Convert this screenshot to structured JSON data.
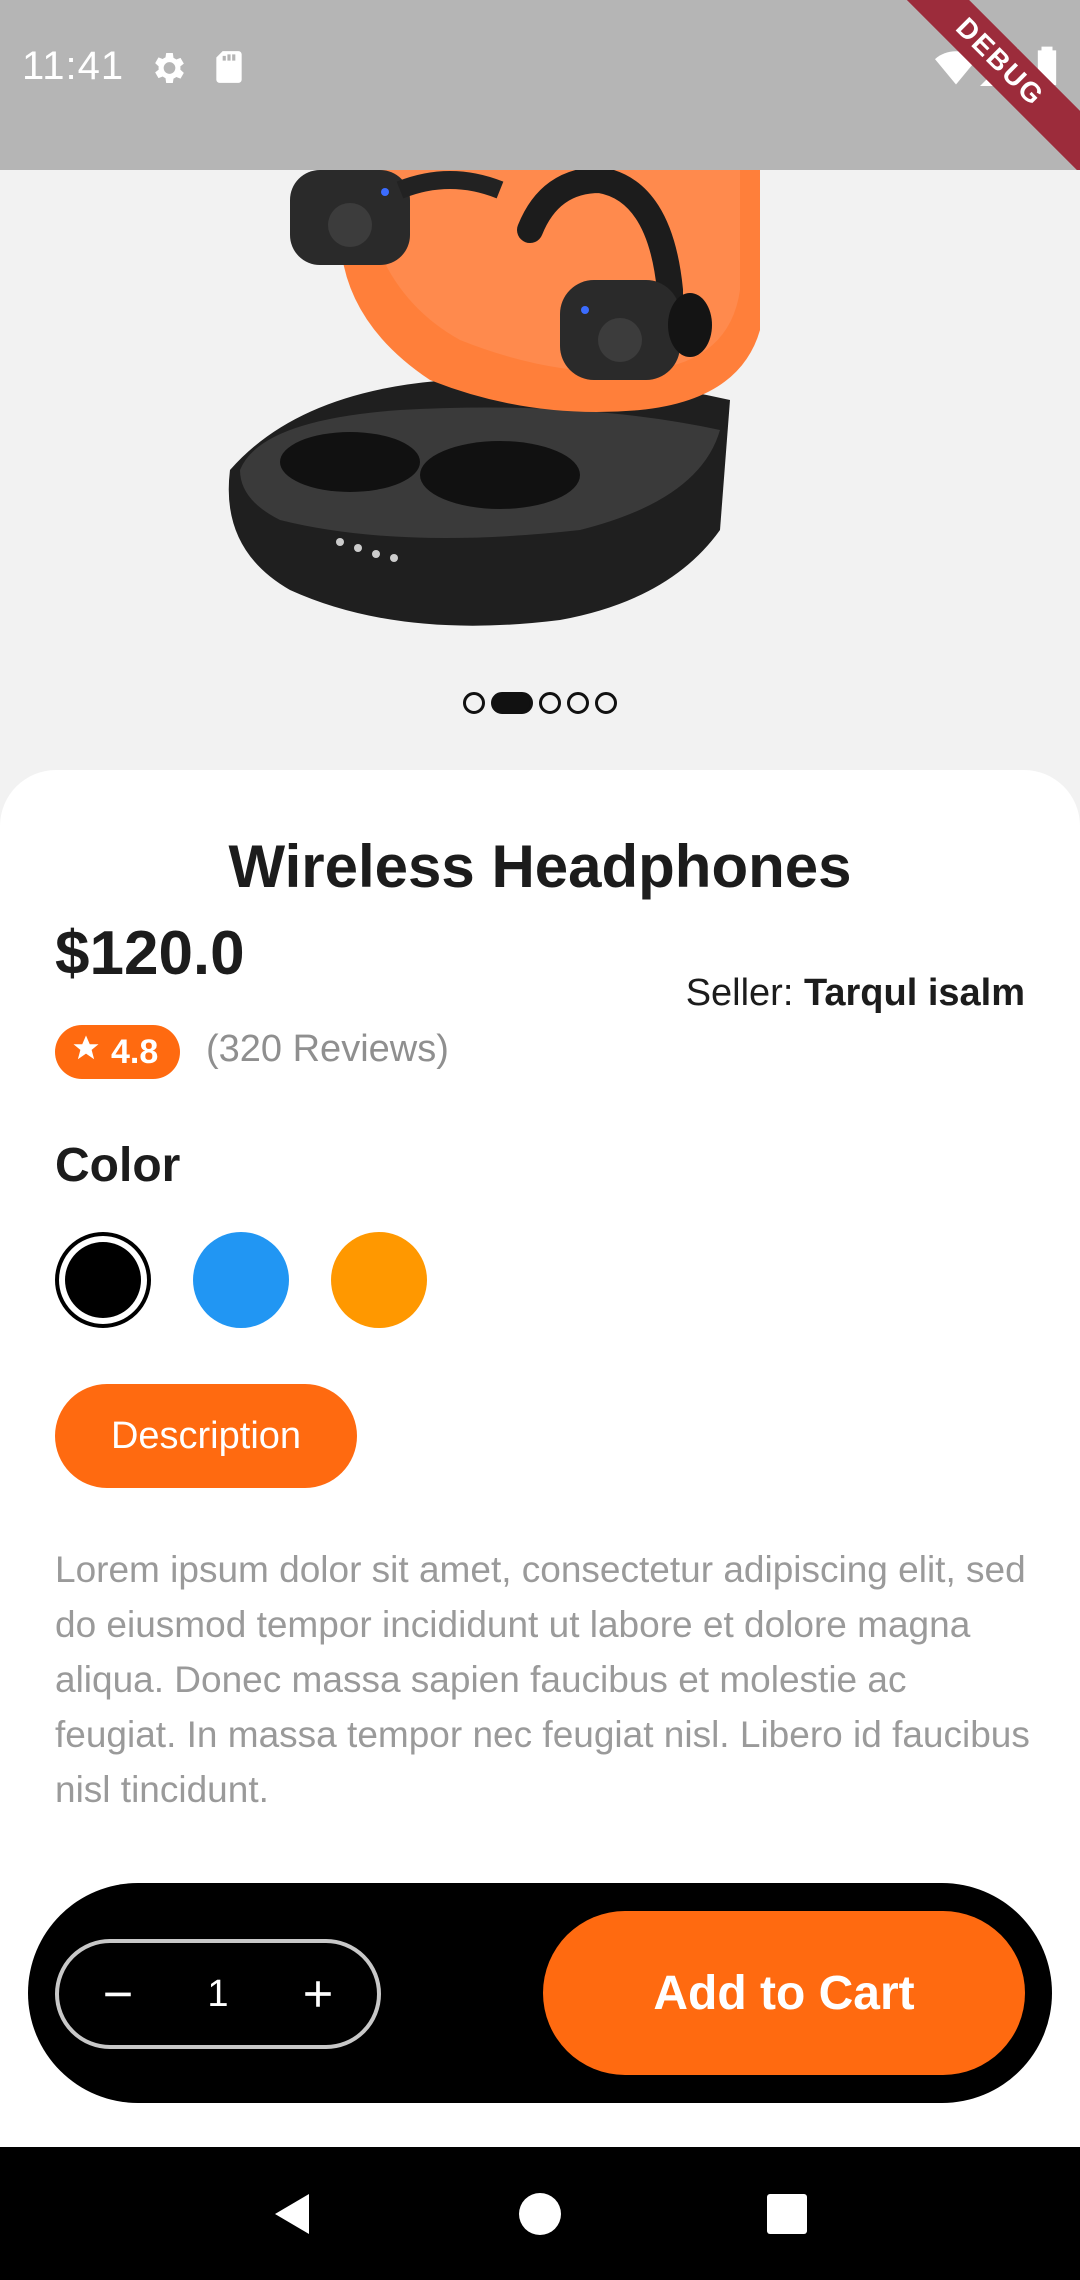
{
  "status_bar": {
    "time": "11:41",
    "icons": [
      "gear-icon",
      "sd-card-icon",
      "wifi-icon",
      "signal-icon",
      "battery-icon"
    ],
    "debug_banner": "DEBUG"
  },
  "hero": {
    "image": "wireless-earbuds-image",
    "carousel": {
      "total": 5,
      "active_index": 1
    }
  },
  "product": {
    "title": "Wireless Headphones",
    "price": "$120.0",
    "seller_label": "Seller: ",
    "seller_name": "Tarqul isalm",
    "rating": "4.8",
    "reviews": "(320 Reviews)",
    "color_label": "Color",
    "colors": [
      "#000000",
      "#2196f3",
      "#ff9800"
    ],
    "selected_color_index": 0,
    "tab_label": "Description",
    "description": "Lorem ipsum dolor sit amet, consectetur adipiscing elit, sed do eiusmod tempor incididunt ut labore et dolore magna aliqua. Donec massa sapien faucibus et molestie ac feugiat. In massa tempor nec feugiat nisl. Libero id faucibus nisl tincidunt."
  },
  "cart": {
    "quantity": "1",
    "add_to_cart_label": "Add to Cart"
  },
  "colors": {
    "accent": "#ff6a10",
    "status_bar": "#b5b5b5",
    "muted_text": "#9a9a9a"
  },
  "nav": [
    "back-icon",
    "home-icon",
    "recents-icon"
  ]
}
